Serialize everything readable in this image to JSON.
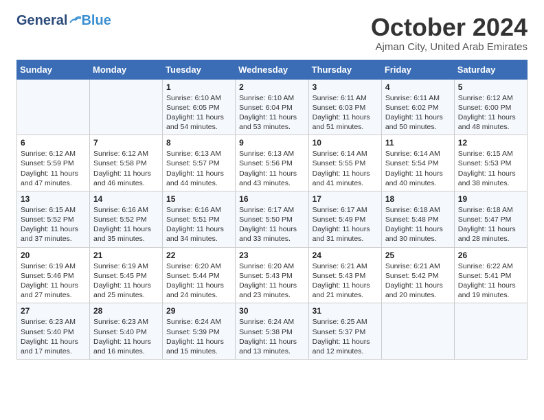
{
  "header": {
    "logo_general": "General",
    "logo_blue": "Blue",
    "month_title": "October 2024",
    "subtitle": "Ajman City, United Arab Emirates"
  },
  "weekdays": [
    "Sunday",
    "Monday",
    "Tuesday",
    "Wednesday",
    "Thursday",
    "Friday",
    "Saturday"
  ],
  "weeks": [
    [
      {
        "day": "",
        "info": ""
      },
      {
        "day": "",
        "info": ""
      },
      {
        "day": "1",
        "info": "Sunrise: 6:10 AM\nSunset: 6:05 PM\nDaylight: 11 hours and 54 minutes."
      },
      {
        "day": "2",
        "info": "Sunrise: 6:10 AM\nSunset: 6:04 PM\nDaylight: 11 hours and 53 minutes."
      },
      {
        "day": "3",
        "info": "Sunrise: 6:11 AM\nSunset: 6:03 PM\nDaylight: 11 hours and 51 minutes."
      },
      {
        "day": "4",
        "info": "Sunrise: 6:11 AM\nSunset: 6:02 PM\nDaylight: 11 hours and 50 minutes."
      },
      {
        "day": "5",
        "info": "Sunrise: 6:12 AM\nSunset: 6:00 PM\nDaylight: 11 hours and 48 minutes."
      }
    ],
    [
      {
        "day": "6",
        "info": "Sunrise: 6:12 AM\nSunset: 5:59 PM\nDaylight: 11 hours and 47 minutes."
      },
      {
        "day": "7",
        "info": "Sunrise: 6:12 AM\nSunset: 5:58 PM\nDaylight: 11 hours and 46 minutes."
      },
      {
        "day": "8",
        "info": "Sunrise: 6:13 AM\nSunset: 5:57 PM\nDaylight: 11 hours and 44 minutes."
      },
      {
        "day": "9",
        "info": "Sunrise: 6:13 AM\nSunset: 5:56 PM\nDaylight: 11 hours and 43 minutes."
      },
      {
        "day": "10",
        "info": "Sunrise: 6:14 AM\nSunset: 5:55 PM\nDaylight: 11 hours and 41 minutes."
      },
      {
        "day": "11",
        "info": "Sunrise: 6:14 AM\nSunset: 5:54 PM\nDaylight: 11 hours and 40 minutes."
      },
      {
        "day": "12",
        "info": "Sunrise: 6:15 AM\nSunset: 5:53 PM\nDaylight: 11 hours and 38 minutes."
      }
    ],
    [
      {
        "day": "13",
        "info": "Sunrise: 6:15 AM\nSunset: 5:52 PM\nDaylight: 11 hours and 37 minutes."
      },
      {
        "day": "14",
        "info": "Sunrise: 6:16 AM\nSunset: 5:52 PM\nDaylight: 11 hours and 35 minutes."
      },
      {
        "day": "15",
        "info": "Sunrise: 6:16 AM\nSunset: 5:51 PM\nDaylight: 11 hours and 34 minutes."
      },
      {
        "day": "16",
        "info": "Sunrise: 6:17 AM\nSunset: 5:50 PM\nDaylight: 11 hours and 33 minutes."
      },
      {
        "day": "17",
        "info": "Sunrise: 6:17 AM\nSunset: 5:49 PM\nDaylight: 11 hours and 31 minutes."
      },
      {
        "day": "18",
        "info": "Sunrise: 6:18 AM\nSunset: 5:48 PM\nDaylight: 11 hours and 30 minutes."
      },
      {
        "day": "19",
        "info": "Sunrise: 6:18 AM\nSunset: 5:47 PM\nDaylight: 11 hours and 28 minutes."
      }
    ],
    [
      {
        "day": "20",
        "info": "Sunrise: 6:19 AM\nSunset: 5:46 PM\nDaylight: 11 hours and 27 minutes."
      },
      {
        "day": "21",
        "info": "Sunrise: 6:19 AM\nSunset: 5:45 PM\nDaylight: 11 hours and 25 minutes."
      },
      {
        "day": "22",
        "info": "Sunrise: 6:20 AM\nSunset: 5:44 PM\nDaylight: 11 hours and 24 minutes."
      },
      {
        "day": "23",
        "info": "Sunrise: 6:20 AM\nSunset: 5:43 PM\nDaylight: 11 hours and 23 minutes."
      },
      {
        "day": "24",
        "info": "Sunrise: 6:21 AM\nSunset: 5:43 PM\nDaylight: 11 hours and 21 minutes."
      },
      {
        "day": "25",
        "info": "Sunrise: 6:21 AM\nSunset: 5:42 PM\nDaylight: 11 hours and 20 minutes."
      },
      {
        "day": "26",
        "info": "Sunrise: 6:22 AM\nSunset: 5:41 PM\nDaylight: 11 hours and 19 minutes."
      }
    ],
    [
      {
        "day": "27",
        "info": "Sunrise: 6:23 AM\nSunset: 5:40 PM\nDaylight: 11 hours and 17 minutes."
      },
      {
        "day": "28",
        "info": "Sunrise: 6:23 AM\nSunset: 5:40 PM\nDaylight: 11 hours and 16 minutes."
      },
      {
        "day": "29",
        "info": "Sunrise: 6:24 AM\nSunset: 5:39 PM\nDaylight: 11 hours and 15 minutes."
      },
      {
        "day": "30",
        "info": "Sunrise: 6:24 AM\nSunset: 5:38 PM\nDaylight: 11 hours and 13 minutes."
      },
      {
        "day": "31",
        "info": "Sunrise: 6:25 AM\nSunset: 5:37 PM\nDaylight: 11 hours and 12 minutes."
      },
      {
        "day": "",
        "info": ""
      },
      {
        "day": "",
        "info": ""
      }
    ]
  ]
}
